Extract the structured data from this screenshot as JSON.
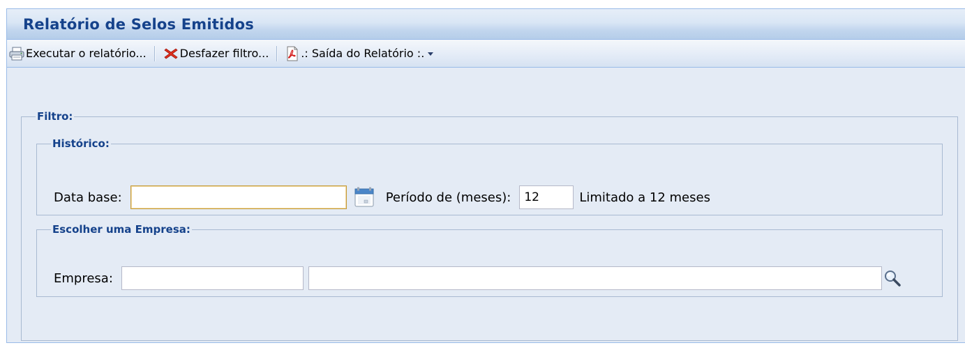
{
  "window": {
    "title": "Relatório de Selos Emitidos"
  },
  "toolbar": {
    "run_report_label": "Executar o relatório...",
    "clear_filter_label": "Desfazer filtro...",
    "report_output_label": ".: Saída do Relatório :."
  },
  "filter": {
    "legend": "Filtro:",
    "history": {
      "legend": "Histórico:",
      "base_date_label": "Data base:",
      "base_date_value": "",
      "period_label": "Período de (meses):",
      "period_value": "12",
      "limit_note": "Limitado a 12 meses"
    },
    "company": {
      "legend": "Escolher uma Empresa:",
      "company_label": "Empresa:",
      "company_code_value": "",
      "company_name_value": ""
    }
  },
  "icons": {
    "run_report": "printer-icon",
    "clear_filter": "red-x-icon",
    "report_output": "pdf-icon",
    "calendar": "calendar-icon",
    "search": "magnifier-icon"
  },
  "colors": {
    "title_text": "#15428b",
    "window_border": "#99bbe8",
    "panel_bg": "#e4ebf5",
    "focus_border": "#c49a3a"
  }
}
